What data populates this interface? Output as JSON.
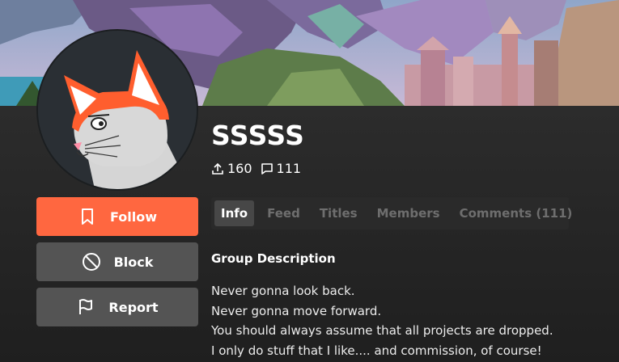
{
  "group": {
    "name": "SSSSS",
    "uploads": "160",
    "comments": "111"
  },
  "actions": {
    "follow": "Follow",
    "block": "Block",
    "report": "Report"
  },
  "tabs": [
    {
      "label": "Info",
      "active": true
    },
    {
      "label": "Feed",
      "active": false
    },
    {
      "label": "Titles",
      "active": false
    },
    {
      "label": "Members",
      "active": false
    },
    {
      "label": "Comments (111)",
      "active": false
    }
  ],
  "description": {
    "heading": "Group Description",
    "lines": [
      "Never gonna look back.",
      "Never gonna move forward.",
      "You should always assume that all projects are dropped.",
      "I only do stuff that I like.... and commission, of course!"
    ]
  },
  "icons": {
    "upload": "upload-icon",
    "comment": "comment-icon",
    "bookmark": "bookmark-icon",
    "block": "block-icon",
    "flag": "flag-icon"
  },
  "colors": {
    "accent": "#ff6740",
    "button_gray": "#545454",
    "background": "#262626"
  }
}
